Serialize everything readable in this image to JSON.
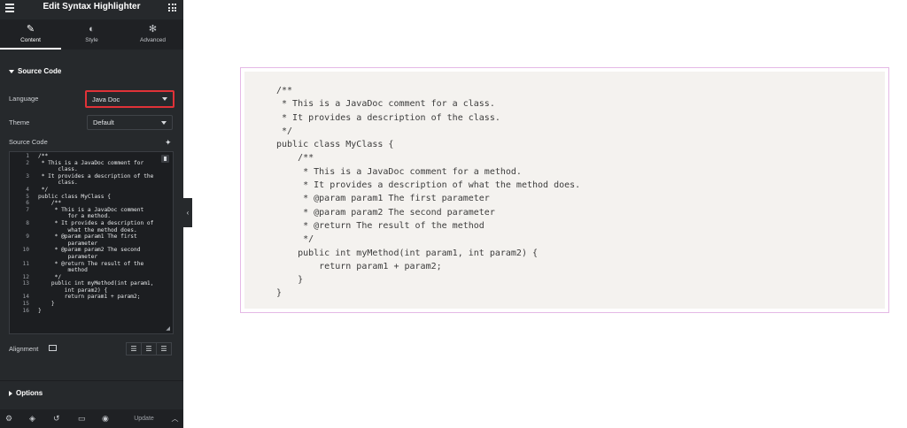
{
  "panel": {
    "title": "Edit Syntax Highlighter",
    "tabs": [
      {
        "label": "Content",
        "icon": "pencil-icon"
      },
      {
        "label": "Style",
        "icon": "half-circle-icon"
      },
      {
        "label": "Advanced",
        "icon": "gear-icon"
      }
    ],
    "section_source": "Source Code",
    "language_label": "Language",
    "language_value": "Java Doc",
    "theme_label": "Theme",
    "theme_value": "Default",
    "source_code_label": "Source Code",
    "editor_lines": [
      {
        "n": "1",
        "t": "/**"
      },
      {
        "n": "2",
        "t": " * This is a JavaDoc comment for"
      },
      {
        "n": "",
        "t": "      class."
      },
      {
        "n": "3",
        "t": " * It provides a description of the"
      },
      {
        "n": "",
        "t": "      class."
      },
      {
        "n": "4",
        "t": " */"
      },
      {
        "n": "5",
        "t": "public class MyClass {"
      },
      {
        "n": "6",
        "t": "    /**"
      },
      {
        "n": "7",
        "t": "     * This is a JavaDoc comment"
      },
      {
        "n": "",
        "t": "         for a method."
      },
      {
        "n": "8",
        "t": "     * It provides a description of"
      },
      {
        "n": "",
        "t": "         what the method does."
      },
      {
        "n": "9",
        "t": "     * @param param1 The first"
      },
      {
        "n": "",
        "t": "         parameter"
      },
      {
        "n": "10",
        "t": "     * @param param2 The second"
      },
      {
        "n": "",
        "t": "         parameter"
      },
      {
        "n": "11",
        "t": "     * @return The result of the"
      },
      {
        "n": "",
        "t": "         method"
      },
      {
        "n": "12",
        "t": "     */"
      },
      {
        "n": "13",
        "t": "    public int myMethod(int param1,"
      },
      {
        "n": "",
        "t": "        int param2) {"
      },
      {
        "n": "14",
        "t": "        return param1 + param2;"
      },
      {
        "n": "15",
        "t": "    }"
      },
      {
        "n": "16",
        "t": "}"
      }
    ],
    "alignment_label": "Alignment",
    "options_label": "Options",
    "update_label": "Update"
  },
  "preview": {
    "code": "/**\n * This is a JavaDoc comment for a class.\n * It provides a description of the class.\n */\npublic class MyClass {\n    /**\n     * This is a JavaDoc comment for a method.\n     * It provides a description of what the method does.\n     * @param param1 The first parameter\n     * @param param2 The second parameter\n     * @return The result of the method\n     */\n    public int myMethod(int param1, int param2) {\n        return param1 + param2;\n    }\n}"
  },
  "colors": {
    "sidebar_bg": "#26292c",
    "highlight_border": "#e03238",
    "preview_border": "#e5b9e6",
    "preview_bg": "#f4f2ef"
  }
}
